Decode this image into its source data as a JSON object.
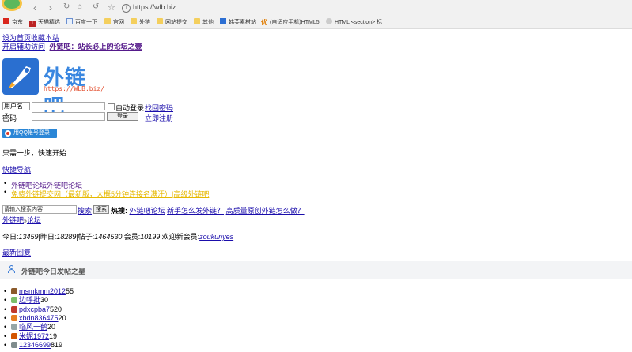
{
  "browser": {
    "address": "https://wlb.biz",
    "bookmarks": [
      {
        "label": "京东",
        "icon": "jd-icon",
        "color": "#d9261c"
      },
      {
        "label": "天猫精选",
        "icon": "tmall-icon",
        "color": "#b22222"
      },
      {
        "label": "百度一下",
        "icon": "page-icon",
        "color": "#6a8fd0"
      },
      {
        "label": "官网",
        "icon": "folder-icon",
        "color": "#f4cf5d"
      },
      {
        "label": "外链",
        "icon": "folder-icon",
        "color": "#f4cf5d"
      },
      {
        "label": "网站提交",
        "icon": "folder-icon",
        "color": "#f4cf5d"
      },
      {
        "label": "其他",
        "icon": "folder-icon",
        "color": "#f4cf5d"
      },
      {
        "label": "韩芙素材站",
        "icon": "hanfu-icon",
        "color": "#2d6fd3"
      },
      {
        "label": "(自适应手机)HTML5",
        "icon": "you-icon",
        "color": "#e07b00"
      },
      {
        "label": "HTML <section> 标",
        "icon": "globe-icon",
        "color": "#cccccc"
      }
    ]
  },
  "top_links": {
    "set_home": "设为首页收藏本站",
    "assist": "开启辅助访问",
    "slogan": "外链吧：站长必上的论坛之壹"
  },
  "logo": {
    "text": "外链吧",
    "url": "https://WLB.biz/"
  },
  "login": {
    "username_select": "用户名",
    "auto_login": "自动登录",
    "forgot": "找回密码",
    "password_label": "密码",
    "login_button": "登录",
    "register": "立即注册",
    "qq_button": "用QQ帐号登录",
    "one_step": "只需一步，快速开始"
  },
  "quick_nav": "快捷导航",
  "nav_items": [
    {
      "label": "外链吧论坛外链吧论坛",
      "style": "purple"
    },
    {
      "label": "免费外链提交网（最新版，大概5分钟连接名满汗）|高级外链吧",
      "style": "yellow"
    }
  ],
  "search": {
    "placeholder": "请输入搜索内容",
    "search_link": "搜索",
    "search_button": "搜索",
    "hot_label": "热搜:",
    "hot_items": [
      "外链吧论坛",
      "新手怎么发外链？",
      "高质量原创外链怎么做？"
    ]
  },
  "breadcrumb": {
    "home": "外链吧",
    "sep": "»",
    "forum": "论坛"
  },
  "stats": {
    "today_label": "今日:",
    "today": "13459",
    "yesterday_label": "昨日:",
    "yesterday": "18289",
    "posts_label": "帖子:",
    "posts": "1464530",
    "members_label": "会员:",
    "members": "10199",
    "welcome_label": "欢迎新会员:",
    "new_member": "zoukunyes"
  },
  "latest_reply": "最新回复",
  "panel_title": "外链吧今日发帖之星",
  "star_users": [
    {
      "name": "msmkmm2012",
      "count": "55",
      "avatar_color": "#8b5a2b"
    },
    {
      "name": "边呼批",
      "count": "30",
      "avatar_color": "#7bbf6a"
    },
    {
      "name": "pdxcpba7",
      "count": "520",
      "avatar_color": "#c0392b"
    },
    {
      "name": "xbdn836475",
      "count": "20",
      "avatar_color": "#e67e22"
    },
    {
      "name": "临风一鹤",
      "count": "20",
      "avatar_color": "#95a5a6"
    },
    {
      "name": "米妮1972",
      "count": "19",
      "avatar_color": "#d35400"
    },
    {
      "name": "12346699",
      "count": "819",
      "avatar_color": "#7f8c8d"
    }
  ]
}
